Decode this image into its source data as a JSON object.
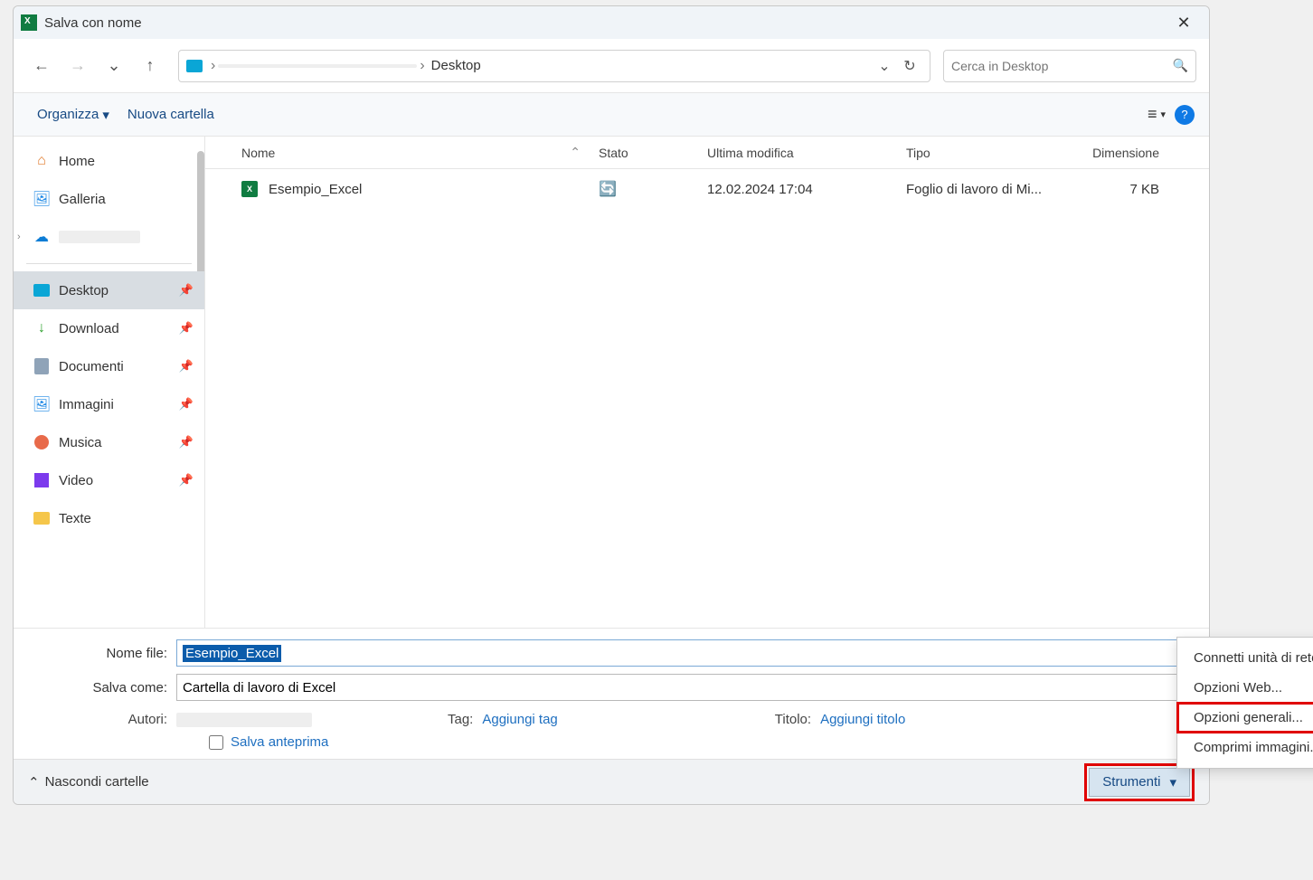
{
  "window": {
    "title": "Salva con nome"
  },
  "nav": {
    "current_folder": "Desktop"
  },
  "search": {
    "placeholder": "Cerca in Desktop"
  },
  "toolbar": {
    "organize": "Organizza",
    "new_folder": "Nuova cartella"
  },
  "sidebar": {
    "items": [
      {
        "label": "Home"
      },
      {
        "label": "Galleria"
      },
      {
        "label": ""
      },
      {
        "label": "Desktop"
      },
      {
        "label": "Download"
      },
      {
        "label": "Documenti"
      },
      {
        "label": "Immagini"
      },
      {
        "label": "Musica"
      },
      {
        "label": "Video"
      },
      {
        "label": "Texte"
      }
    ]
  },
  "columns": {
    "name": "Nome",
    "state": "Stato",
    "modified": "Ultima modifica",
    "type": "Tipo",
    "size": "Dimensione"
  },
  "files": [
    {
      "name": "Esempio_Excel",
      "modified": "12.02.2024 17:04",
      "type": "Foglio di lavoro di Mi...",
      "size": "7 KB"
    }
  ],
  "form": {
    "filename_label": "Nome file:",
    "filename_value": "Esempio_Excel",
    "saveas_label": "Salva come:",
    "saveas_value": "Cartella di lavoro di Excel",
    "authors_label": "Autori:",
    "tag_label": "Tag:",
    "tag_link": "Aggiungi tag",
    "title_label": "Titolo:",
    "title_link": "Aggiungi titolo",
    "preview_label": "Salva anteprima"
  },
  "footer": {
    "hide_folders": "Nascondi cartelle",
    "tools": "Strumenti",
    "menu": {
      "network": "Connetti unità di rete...",
      "web": "Opzioni Web...",
      "general": "Opzioni generali...",
      "compress": "Comprimi immagini..."
    }
  }
}
